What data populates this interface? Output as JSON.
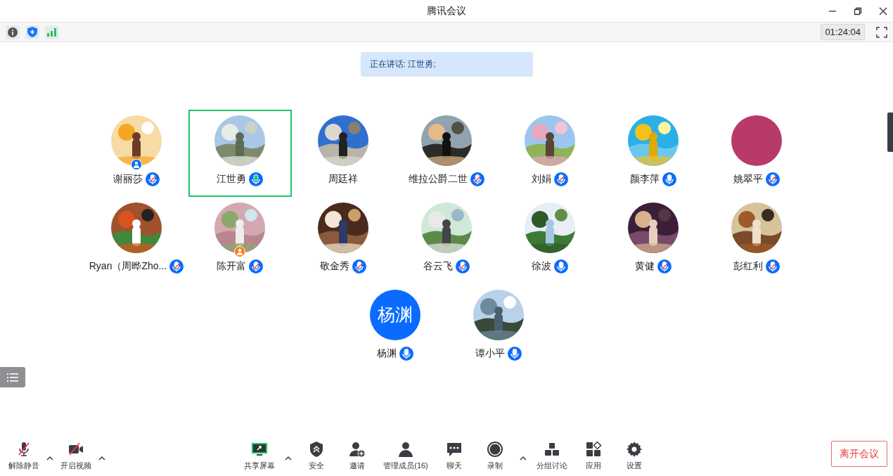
{
  "window": {
    "title": "腾讯会议"
  },
  "top_toolbar": {
    "timer": "01:24:04"
  },
  "speaking_banner": "正在讲话: 江世勇;",
  "participants": [
    {
      "name": "谢丽莎",
      "badge": {
        "color": "#0a6cff"
      },
      "mic": {
        "muted": true
      },
      "selected": false
    },
    {
      "name": "江世勇",
      "mic": {
        "muted": false
      },
      "selected": true
    },
    {
      "name": "周廷祥",
      "selected": false
    },
    {
      "name": "维拉公爵二世",
      "mic": {
        "muted": true
      },
      "selected": false
    },
    {
      "name": "刘娟",
      "mic": {
        "muted": true
      },
      "selected": false
    },
    {
      "name": "颜李萍",
      "mic": {
        "muted": false
      },
      "selected": false
    },
    {
      "name": "姚翠平",
      "avatar": {
        "kind": "color",
        "color": "#b83a68"
      },
      "mic": {
        "muted": true
      },
      "selected": false
    },
    {
      "name": "Ryan（周晔Zho...",
      "mic": {
        "muted": true
      },
      "selected": false
    },
    {
      "name": "陈开富",
      "badge": {
        "color": "#ff7a1a"
      },
      "mic": {
        "muted": true
      },
      "selected": false
    },
    {
      "name": "敬金秀",
      "mic": {
        "muted": true
      },
      "selected": false
    },
    {
      "name": "谷云飞",
      "mic": {
        "muted": true
      },
      "selected": false
    },
    {
      "name": "徐波",
      "mic": {
        "muted": false
      },
      "selected": false
    },
    {
      "name": "黄健",
      "mic": {
        "muted": true
      },
      "selected": false
    },
    {
      "name": "彭红利",
      "mic": {
        "muted": true
      },
      "selected": false
    },
    {
      "name": "杨渊",
      "avatar": {
        "kind": "initials",
        "text": "杨渊",
        "color": "#0a6cff"
      },
      "mic": {
        "muted": false
      },
      "selected": false
    },
    {
      "name": "谭小平",
      "mic": {
        "muted": false
      },
      "selected": false
    }
  ],
  "bottom_toolbar": {
    "left": [
      {
        "label": "解除静音",
        "off": true,
        "caret": true
      },
      {
        "label": "开启视频",
        "off": true,
        "caret": true
      }
    ],
    "center": [
      {
        "label": "共享屏幕",
        "caret": true
      },
      {
        "label": "安全"
      },
      {
        "label": "邀请"
      },
      {
        "label": "管理成员(16)"
      },
      {
        "label": "聊天"
      },
      {
        "label": "录制",
        "caret": true
      },
      {
        "label": "分组讨论"
      },
      {
        "label": "应用"
      },
      {
        "label": "设置"
      }
    ],
    "leave_button": "离开会议"
  }
}
